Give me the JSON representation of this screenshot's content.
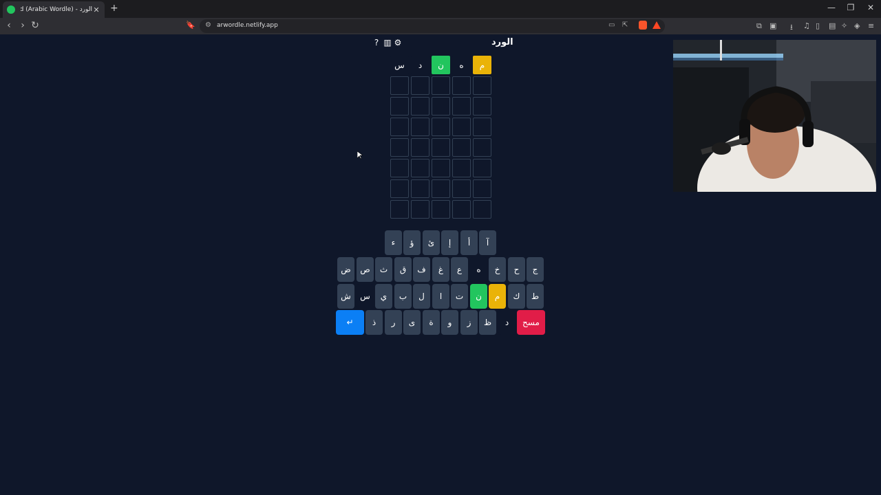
{
  "browser": {
    "tab_title": "الورد - AlWird (Arabic Wordle)",
    "url": "arwordle.netlify.app",
    "new_tab": "+",
    "tab_close": "✕",
    "win_min": "—",
    "win_max": "❐",
    "win_close": "✕",
    "back": "‹",
    "forward": "›",
    "reload": "↻"
  },
  "game": {
    "title": "الورد",
    "help_icon": "?",
    "stats_icon": "▥",
    "settings_icon": "⚙"
  },
  "colors": {
    "background": "#0f172a",
    "correct": "#22c55e",
    "present": "#eab308",
    "absent": "#0f172a",
    "empty_border": "#334155",
    "enter": "#0b7ff5",
    "delete": "#e11d48"
  },
  "board": [
    [
      {
        "letter": "س",
        "state": "absent"
      },
      {
        "letter": "د",
        "state": "absent"
      },
      {
        "letter": "ن",
        "state": "correct"
      },
      {
        "letter": "ه",
        "state": "absent"
      },
      {
        "letter": "م",
        "state": "present"
      }
    ],
    [
      {
        "letter": "",
        "state": "empty"
      },
      {
        "letter": "",
        "state": "empty"
      },
      {
        "letter": "",
        "state": "empty"
      },
      {
        "letter": "",
        "state": "empty"
      },
      {
        "letter": "",
        "state": "empty"
      }
    ],
    [
      {
        "letter": "",
        "state": "empty"
      },
      {
        "letter": "",
        "state": "empty"
      },
      {
        "letter": "",
        "state": "empty"
      },
      {
        "letter": "",
        "state": "empty"
      },
      {
        "letter": "",
        "state": "empty"
      }
    ],
    [
      {
        "letter": "",
        "state": "empty"
      },
      {
        "letter": "",
        "state": "empty"
      },
      {
        "letter": "",
        "state": "empty"
      },
      {
        "letter": "",
        "state": "empty"
      },
      {
        "letter": "",
        "state": "empty"
      }
    ],
    [
      {
        "letter": "",
        "state": "empty"
      },
      {
        "letter": "",
        "state": "empty"
      },
      {
        "letter": "",
        "state": "empty"
      },
      {
        "letter": "",
        "state": "empty"
      },
      {
        "letter": "",
        "state": "empty"
      }
    ],
    [
      {
        "letter": "",
        "state": "empty"
      },
      {
        "letter": "",
        "state": "empty"
      },
      {
        "letter": "",
        "state": "empty"
      },
      {
        "letter": "",
        "state": "empty"
      },
      {
        "letter": "",
        "state": "empty"
      }
    ],
    [
      {
        "letter": "",
        "state": "empty"
      },
      {
        "letter": "",
        "state": "empty"
      },
      {
        "letter": "",
        "state": "empty"
      },
      {
        "letter": "",
        "state": "empty"
      },
      {
        "letter": "",
        "state": "empty"
      }
    ],
    [
      {
        "letter": "",
        "state": "empty"
      },
      {
        "letter": "",
        "state": "empty"
      },
      {
        "letter": "",
        "state": "empty"
      },
      {
        "letter": "",
        "state": "empty"
      },
      {
        "letter": "",
        "state": "empty"
      }
    ]
  ],
  "keyboard": {
    "row1": [
      {
        "label": "ء",
        "state": "unused"
      },
      {
        "label": "ؤ",
        "state": "unused"
      },
      {
        "label": "ئ",
        "state": "unused"
      },
      {
        "label": "إ",
        "state": "unused"
      },
      {
        "label": "أ",
        "state": "unused"
      },
      {
        "label": "آ",
        "state": "unused"
      }
    ],
    "row2": [
      {
        "label": "ض",
        "state": "unused"
      },
      {
        "label": "ص",
        "state": "unused"
      },
      {
        "label": "ث",
        "state": "unused"
      },
      {
        "label": "ق",
        "state": "unused"
      },
      {
        "label": "ف",
        "state": "unused"
      },
      {
        "label": "غ",
        "state": "unused"
      },
      {
        "label": "ع",
        "state": "unused"
      },
      {
        "label": "ه",
        "state": "absent"
      },
      {
        "label": "خ",
        "state": "unused"
      },
      {
        "label": "ح",
        "state": "unused"
      },
      {
        "label": "ج",
        "state": "unused"
      }
    ],
    "row3": [
      {
        "label": "ش",
        "state": "unused"
      },
      {
        "label": "س",
        "state": "absent"
      },
      {
        "label": "ي",
        "state": "unused"
      },
      {
        "label": "ب",
        "state": "unused"
      },
      {
        "label": "ل",
        "state": "unused"
      },
      {
        "label": "ا",
        "state": "unused"
      },
      {
        "label": "ت",
        "state": "unused"
      },
      {
        "label": "ن",
        "state": "correct"
      },
      {
        "label": "م",
        "state": "present"
      },
      {
        "label": "ك",
        "state": "unused"
      },
      {
        "label": "ط",
        "state": "unused"
      }
    ],
    "row4": [
      {
        "label": "↵",
        "state": "enter"
      },
      {
        "label": "ذ",
        "state": "unused"
      },
      {
        "label": "ر",
        "state": "unused"
      },
      {
        "label": "ى",
        "state": "unused"
      },
      {
        "label": "ة",
        "state": "unused"
      },
      {
        "label": "و",
        "state": "unused"
      },
      {
        "label": "ز",
        "state": "unused"
      },
      {
        "label": "ظ",
        "state": "unused"
      },
      {
        "label": "د",
        "state": "absent"
      },
      {
        "label": "مسح",
        "state": "delete"
      }
    ]
  }
}
